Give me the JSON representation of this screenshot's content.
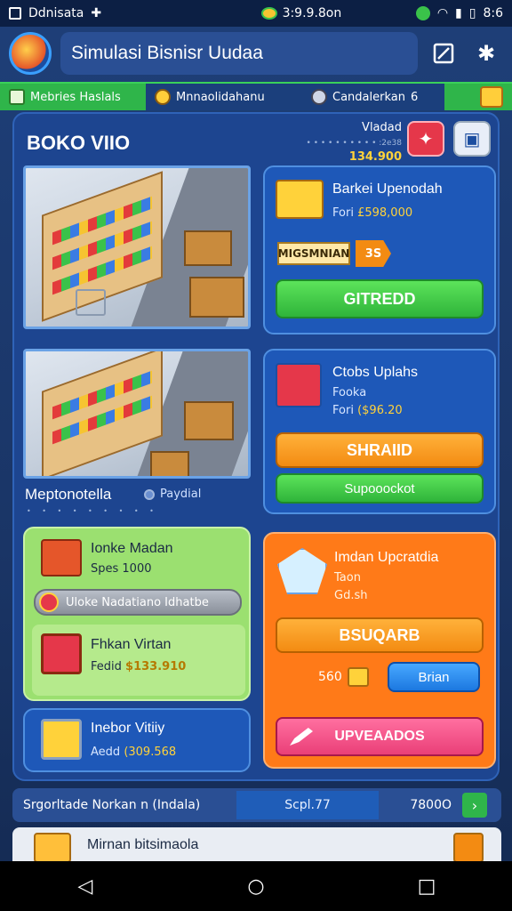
{
  "status_bar": {
    "left_text": "Ddnisata",
    "center_text": "3:9.9.8on",
    "right_text": "8:6"
  },
  "header": {
    "title": "Simulasi Bisnisr Uudaa"
  },
  "tabs": [
    {
      "label": "Mebries Haslals",
      "active": true
    },
    {
      "label": "Mnnaolidahanu",
      "active": false
    },
    {
      "label": "Candalerkan",
      "badge": "6",
      "active": false
    }
  ],
  "store": {
    "name": "BOKO VIIO",
    "money_label": "Vladad",
    "money_value": "134.900",
    "money_dots": "• • • • • • • • • • :2e38"
  },
  "cards": {
    "basic_upgrade": {
      "title": "Barkei Upenodah",
      "sub_prefix": "Fori",
      "sub_value": "£598,000",
      "mission_label": "MIGSMNIAN",
      "mission_badge": "3S",
      "button": "GITREDD"
    },
    "stock_upgrade": {
      "title": "Ctobs Uplahs",
      "line1": "Fooka",
      "sub_prefix": "Fori",
      "sub_value": "($96.20",
      "button_primary": "SHRAIID",
      "button_secondary": "Supooockot"
    },
    "premium_upgrade": {
      "title": "Imdan Upcratdia",
      "line1": "Taon",
      "line2": "Gd.sh",
      "button_primary": "BSUQARB",
      "counter": "560",
      "button_secondary": "Brian",
      "button_pink": "UPVEAADOS"
    }
  },
  "management": {
    "heading": "Meptonotella",
    "tag": "Paydial"
  },
  "items": [
    {
      "title": "Ionke Madan",
      "sub": "Spes 1000"
    },
    {
      "pill": "Uloke Nadatiano Idhatbe"
    },
    {
      "title": "Fhkan Virtan",
      "sub_prefix": "Fedid",
      "sub_value": "$133.910"
    },
    {
      "title": "Inebor Vitiiy",
      "sub_prefix": "Aedd",
      "sub_value": "(309.568"
    }
  ],
  "bottom_bar": {
    "label": "Srgorltade Norkan n (Indala)",
    "value": "Scpl.77",
    "value2": "7800O"
  },
  "notification": {
    "text": "Mirnan bitsimaola"
  },
  "colors": {
    "accent_green": "#2fb54a",
    "accent_orange": "#f38b12",
    "accent_blue": "#1c78e0",
    "accent_pink": "#ea3f78",
    "panel": "#1d4590",
    "money_yellow": "#ffd23a"
  }
}
